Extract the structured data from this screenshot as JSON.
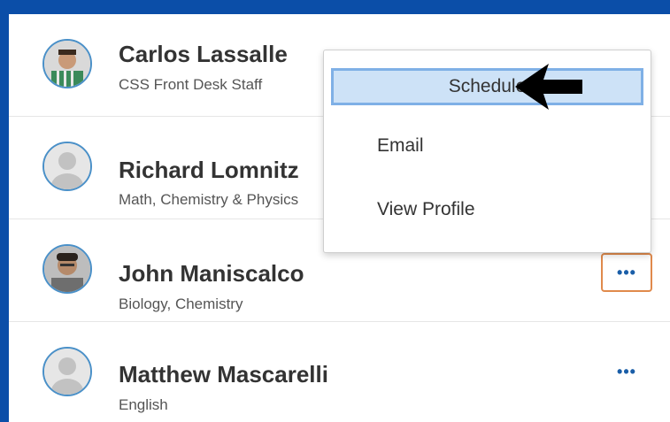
{
  "staff": [
    {
      "name": "Carlos Lassalle",
      "role": "CSS Front Desk Staff",
      "avatar": "photo-icon"
    },
    {
      "name": "Richard Lomnitz",
      "role": "Math, Chemistry & Physics",
      "avatar": "default-user-icon"
    },
    {
      "name": "John Maniscalco",
      "role": "Biology, Chemistry",
      "avatar": "photo-icon"
    },
    {
      "name": "Matthew Mascarelli",
      "role": "English",
      "avatar": "default-user-icon"
    }
  ],
  "more_label": "•••",
  "menu": {
    "items": [
      {
        "label": "Schedule",
        "highlighted": true
      },
      {
        "label": "Email"
      },
      {
        "label": "View Profile"
      }
    ]
  },
  "colors": {
    "background": "#0b4ea8",
    "accent_blue": "#1a5ea8",
    "highlight": "#cde2f7",
    "active_border": "#e08a4c"
  }
}
